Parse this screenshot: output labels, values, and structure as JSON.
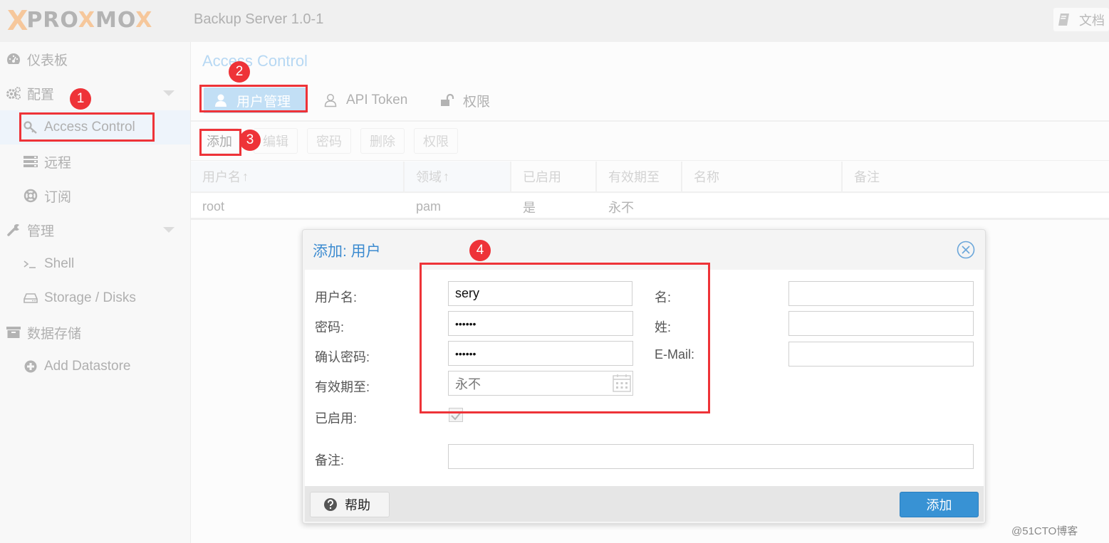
{
  "app": {
    "logo": {
      "prefix": "X",
      "name_a": "PRO",
      "name_x": "X",
      "name_b": "MO",
      "name_x2": "X"
    },
    "version": "Backup Server 1.0-1",
    "docs_label": "文档"
  },
  "sidebar": {
    "items": [
      {
        "label": "仪表板",
        "icon": "dashboard-icon"
      },
      {
        "label": "配置",
        "icon": "gears-icon",
        "expandable": true
      },
      {
        "label": "Access Control",
        "icon": "key-icon",
        "selected": true
      },
      {
        "label": "远程",
        "icon": "server-icon"
      },
      {
        "label": "订阅",
        "icon": "support-icon"
      },
      {
        "label": "管理",
        "icon": "wrench-icon",
        "expandable": true
      },
      {
        "label": "Shell",
        "icon": "terminal-icon"
      },
      {
        "label": "Storage / Disks",
        "icon": "hdd-icon"
      },
      {
        "label": "数据存储",
        "icon": "archive-icon"
      },
      {
        "label": "Add Datastore",
        "icon": "plus-circle-icon"
      }
    ]
  },
  "main": {
    "title": "Access Control",
    "tabs": [
      {
        "label": "用户管理",
        "icon": "user-icon",
        "active": true
      },
      {
        "label": "API Token",
        "icon": "user-outline-icon"
      },
      {
        "label": "权限",
        "icon": "unlock-icon"
      }
    ],
    "toolbar": {
      "add": "添加",
      "edit": "编辑",
      "password": "密码",
      "delete": "删除",
      "permissions": "权限"
    },
    "grid": {
      "columns": [
        "用户名",
        "领域",
        "已启用",
        "有效期至",
        "名称",
        "备注"
      ],
      "sort_arrow": "↑",
      "rows": [
        {
          "username": "root",
          "realm": "pam",
          "enabled": "是",
          "expire": "永不",
          "name": "",
          "comment": ""
        }
      ]
    }
  },
  "dialog": {
    "title": "添加: 用户",
    "fields": {
      "username": {
        "label": "用户名:",
        "value": "sery"
      },
      "password": {
        "label": "密码:",
        "value": "••••••"
      },
      "confirm_password": {
        "label": "确认密码:",
        "value": "••••••"
      },
      "expire": {
        "label": "有效期至:",
        "value": "永不"
      },
      "enabled": {
        "label": "已启用:",
        "checked": true
      },
      "firstname": {
        "label": "名:",
        "value": ""
      },
      "lastname": {
        "label": "姓:",
        "value": ""
      },
      "email": {
        "label": "E-Mail:",
        "value": ""
      },
      "comment": {
        "label": "备注:",
        "value": ""
      }
    },
    "help_label": "帮助",
    "submit_label": "添加"
  },
  "annotations": [
    "1",
    "2",
    "3",
    "4"
  ],
  "colors": {
    "accent": "#3892d4",
    "title_blue": "#3c8bd0",
    "annotation_red": "#ee3338",
    "tab_active_bg": "#c2dff5"
  },
  "watermark": "@51CTO博客"
}
